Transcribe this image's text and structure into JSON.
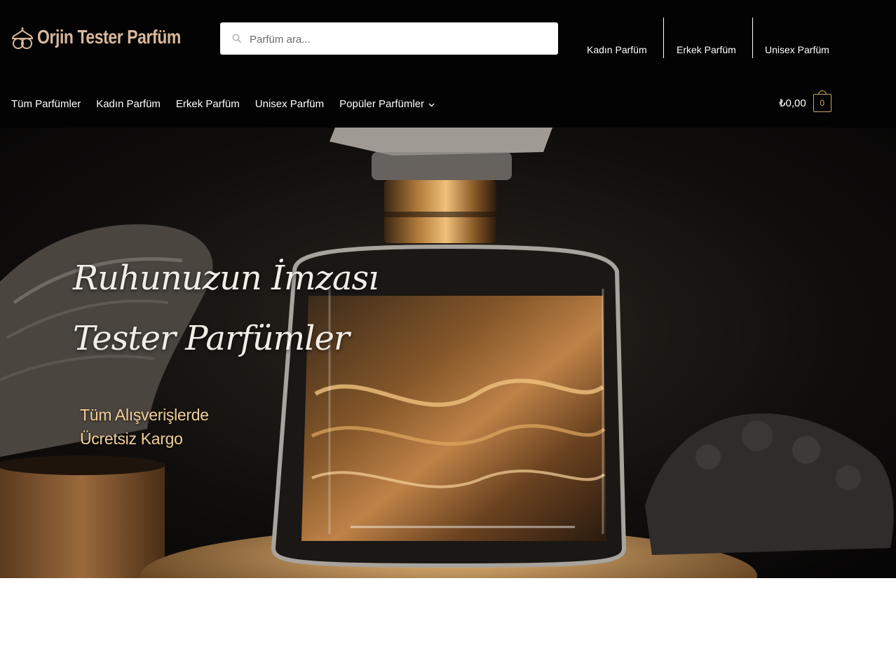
{
  "header": {
    "logo_text": "Orjin Tester Parfüm",
    "search": {
      "placeholder": "Parfüm ara..."
    },
    "secondary_nav": [
      "Kadın Parfüm",
      "Erkek Parfüm",
      "Unisex Parfüm"
    ],
    "primary_nav": [
      "Tüm Parfümler",
      "Kadın Parfüm",
      "Erkek Parfüm",
      "Unisex Parfüm",
      "Popüler Parfümler"
    ],
    "cart": {
      "amount": "₺0,00",
      "count": "0"
    }
  },
  "hero": {
    "headline_1": "Ruhunuzun İmzası",
    "headline_2": "Tester Parfümler",
    "sub_1": "Tüm Alışverişlerde",
    "sub_2": "Ücretsiz Kargo"
  },
  "colors": {
    "header_bg": "#030303",
    "logo_gold": "#d9b89a",
    "cart_gold": "#c9a36a",
    "hero_sub_text": "#f1cf98"
  },
  "icons": {
    "logo": "perfume-drop-logo-icon",
    "search": "search-icon",
    "dropdown": "chevron-down-icon",
    "cart": "cart-bag-icon"
  }
}
